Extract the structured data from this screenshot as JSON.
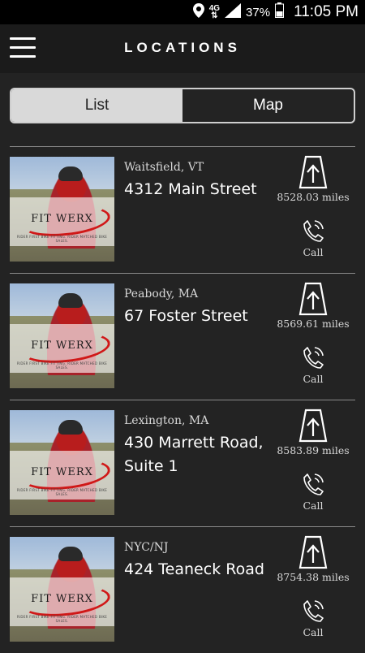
{
  "status_bar": {
    "network": "4G",
    "battery_percent": "37%",
    "time": "11:05 PM",
    "icons": [
      "location-icon",
      "signal-icon",
      "battery-icon"
    ]
  },
  "header": {
    "title": "LOCATIONS",
    "menu_icon": "hamburger-menu-icon"
  },
  "segmented_control": {
    "tabs": [
      {
        "label": "List",
        "selected": true
      },
      {
        "label": "Map",
        "selected": false
      }
    ]
  },
  "locations": [
    {
      "city": "Waitsfield, VT",
      "street": "4312 Main Street",
      "distance": "8528.03 miles",
      "call_label": "Call",
      "logo_text": "FIT WERX",
      "logo_tagline": "RIDER FIRST BIKE FITTING. RIDER MATCHED BIKE SALES."
    },
    {
      "city": "Peabody, MA",
      "street": "67 Foster Street",
      "distance": "8569.61 miles",
      "call_label": "Call",
      "logo_text": "FIT WERX",
      "logo_tagline": "RIDER FIRST BIKE FITTING. RIDER MATCHED BIKE SALES."
    },
    {
      "city": "Lexington, MA",
      "street": "430 Marrett Road, Suite 1",
      "distance": "8583.89 miles",
      "call_label": "Call",
      "logo_text": "FIT WERX",
      "logo_tagline": "RIDER FIRST BIKE FITTING. RIDER MATCHED BIKE SALES."
    },
    {
      "city": "NYC/NJ",
      "street": "424 Teaneck Road",
      "distance": "8754.38 miles",
      "call_label": "Call",
      "logo_text": "FIT WERX",
      "logo_tagline": "RIDER FIRST BIKE FITTING. RIDER MATCHED BIKE SALES."
    }
  ],
  "colors": {
    "background": "#232323",
    "header": "#1b1b1b",
    "segment_active": "#d9d9d9",
    "logo_red": "#d01818"
  }
}
